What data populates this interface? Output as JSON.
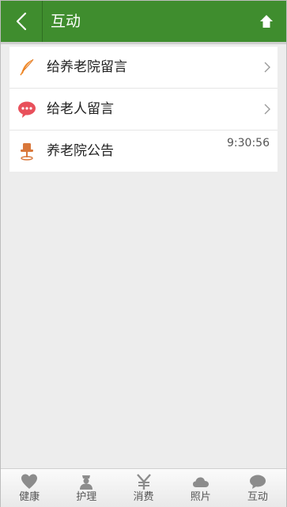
{
  "header": {
    "title": "互动"
  },
  "list": {
    "items": [
      {
        "label": "给养老院留言",
        "icon": "feather-icon"
      },
      {
        "label": "给老人留言",
        "icon": "chat-bubble-icon"
      },
      {
        "label": "养老院公告",
        "icon": "pushpin-icon",
        "time": "9:30:56"
      }
    ]
  },
  "tabbar": {
    "tabs": [
      {
        "label": "健康",
        "icon": "heart-icon"
      },
      {
        "label": "护理",
        "icon": "nurse-icon"
      },
      {
        "label": "消费",
        "icon": "yen-icon"
      },
      {
        "label": "照片",
        "icon": "cloud-icon"
      },
      {
        "label": "互动",
        "icon": "chat-icon"
      }
    ]
  },
  "colors": {
    "header_bg": "#3f8d2e",
    "feather": "#f08a2a",
    "chat_bubble": "#e8505b",
    "pushpin": "#d9773a",
    "tab_icon": "#8c8c8c"
  }
}
